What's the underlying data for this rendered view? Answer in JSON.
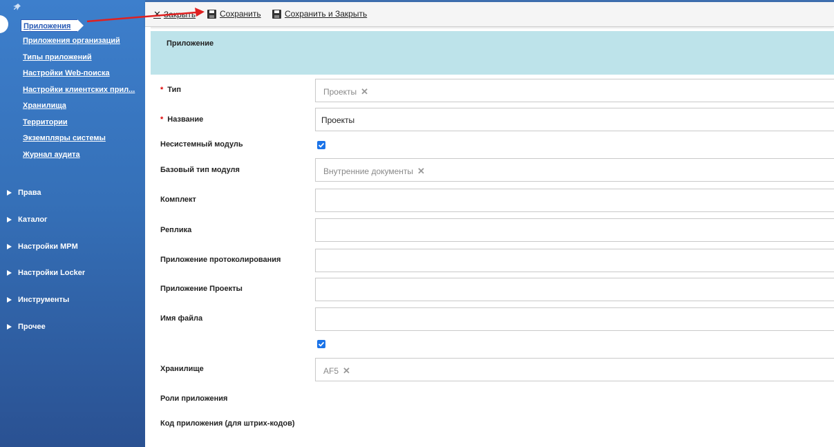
{
  "sidebar": {
    "sub_items": [
      {
        "label": "Приложения",
        "active": true
      },
      {
        "label": "Приложения организаций"
      },
      {
        "label": "Типы приложений"
      },
      {
        "label": "Настройки Web-поиска"
      },
      {
        "label": "Настройки клиентских прил..."
      },
      {
        "label": "Хранилища"
      },
      {
        "label": "Территории"
      },
      {
        "label": "Экземпляры системы"
      },
      {
        "label": "Журнал аудита"
      }
    ],
    "groups": [
      {
        "label": "Права"
      },
      {
        "label": "Каталог"
      },
      {
        "label": "Настройки MPM"
      },
      {
        "label": "Настройки Locker"
      },
      {
        "label": "Инструменты"
      },
      {
        "label": "Прочее"
      }
    ]
  },
  "toolbar": {
    "close_label": "Закрыть",
    "save_label": "Сохранить",
    "save_close_label": "Сохранить и Закрыть"
  },
  "form": {
    "title": "Приложение",
    "type_label": "Тип",
    "type_value": "Проекты",
    "name_label": "Название",
    "name_value": "Проекты",
    "nonsystem_label": "Несистемный модуль",
    "nonsystem_checked": true,
    "base_type_label": "Базовый тип модуля",
    "base_type_value": "Внутренние документы",
    "kit_label": "Комплект",
    "replica_label": "Реплика",
    "logging_app_label": "Приложение протоколирования",
    "projects_app_label": "Приложение Проекты",
    "filename_label": "Имя файла",
    "extra_checked": true,
    "storage_label": "Хранилище",
    "storage_value": "AF5",
    "roles_label": "Роли приложения",
    "barcode_label": "Код приложения (для штрих-кодов)"
  },
  "colors": {
    "sidebar": "#3570b8",
    "band": "#bde3ea",
    "required": "#dd0000",
    "checkbox": "#1a73e8",
    "annotation_arrow": "#e02020"
  }
}
